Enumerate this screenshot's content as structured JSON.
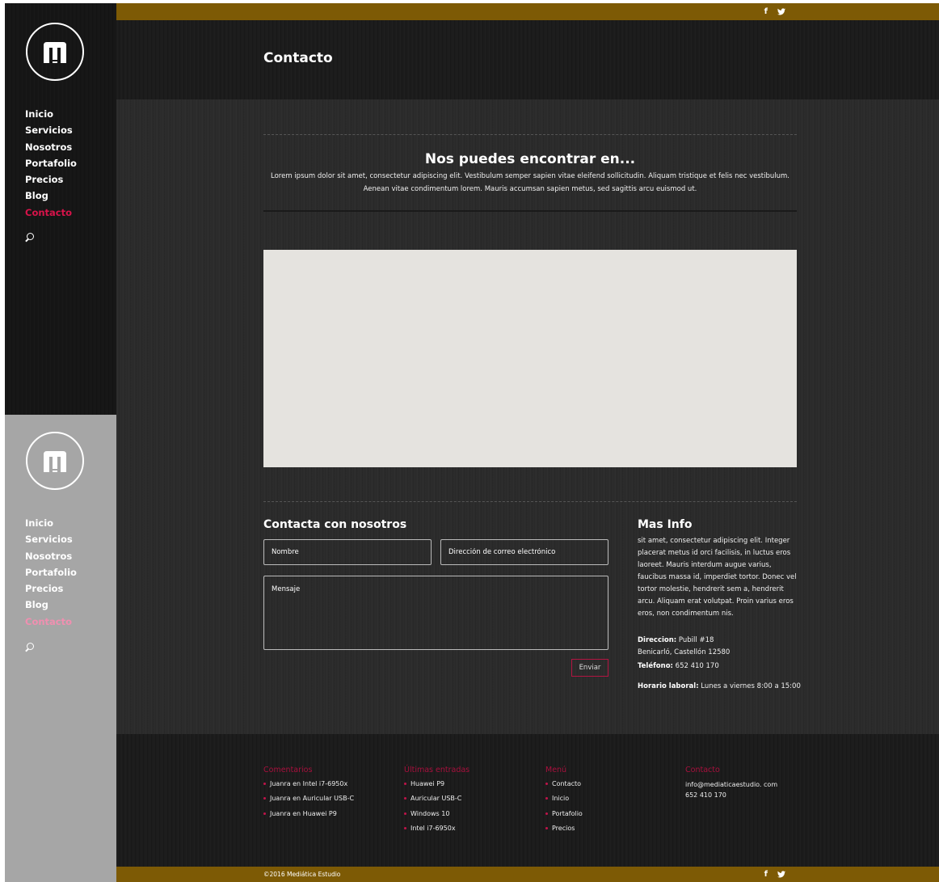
{
  "sidebar": {
    "nav_items": [
      {
        "label": "Inicio"
      },
      {
        "label": "Servicios"
      },
      {
        "label": "Nosotros"
      },
      {
        "label": "Portafolio"
      },
      {
        "label": "Precios"
      },
      {
        "label": "Blog"
      },
      {
        "label": "Contacto",
        "active": true
      }
    ]
  },
  "topbar": {
    "facebook": "f",
    "twitter": "🐦"
  },
  "header": {
    "title": "Contacto"
  },
  "location": {
    "title": "Nos puedes encontrar en...",
    "text": "Lorem ipsum dolor sit amet, consectetur adipiscing elit. Vestibulum semper sapien vitae eleifend sollicitudin. Aliquam tristique et felis nec vestibulum. Aenean vitae condimentum lorem. Mauris accumsan sapien metus, sed sagittis arcu euismod ut."
  },
  "contact_form": {
    "title": "Contacta con nosotros",
    "name_placeholder": "Nombre",
    "email_placeholder": "Dirección de correo electrónico",
    "message_placeholder": "Mensaje",
    "send_label": "Enviar"
  },
  "more_info": {
    "title": "Mas Info",
    "text": "sit amet, consectetur adipiscing elit. Integer placerat metus id orci facilisis, in luctus eros laoreet. Mauris interdum augue varius, faucibus massa id, imperdiet tortor. Donec vel tortor molestie, hendrerit sem a, hendrerit arcu. Aliquam erat volutpat. Proin varius eros eros, non condimentum nis.",
    "address_label": "Direccion:",
    "address_line1": " Pubill #18",
    "address_line2": "Benicarló, Castellón 12580",
    "phone_label": "Teléfono:",
    "phone_value": " 652 410 170",
    "hours_label": "Horario laboral:",
    "hours_value": " Lunes a viernes 8:00 a 15:00"
  },
  "footer": {
    "comments": {
      "title": "Comentarios",
      "items": [
        "Juanra en Intel i7-6950x",
        "Juanra en Auricular USB-C",
        "Juanra en Huawei P9"
      ]
    },
    "latest": {
      "title": "Últimas entradas",
      "items": [
        "Huawei P9",
        "Auricular USB-C",
        "Windows 10",
        "Intel i7-6950x"
      ]
    },
    "menu": {
      "title": "Menú",
      "items": [
        "Contacto",
        "Inicio",
        "Portafolio",
        "Precios"
      ]
    },
    "contact": {
      "title": "Contacto",
      "email": "info@mediaticaestudio. com",
      "phone": "652 410 170"
    },
    "copyright": "©2016 Mediática Estudio"
  },
  "colors": {
    "accent": "#d8134a",
    "gold": "#7d5a05",
    "dark": "#1a1a1a",
    "map": "#e5e3df"
  }
}
